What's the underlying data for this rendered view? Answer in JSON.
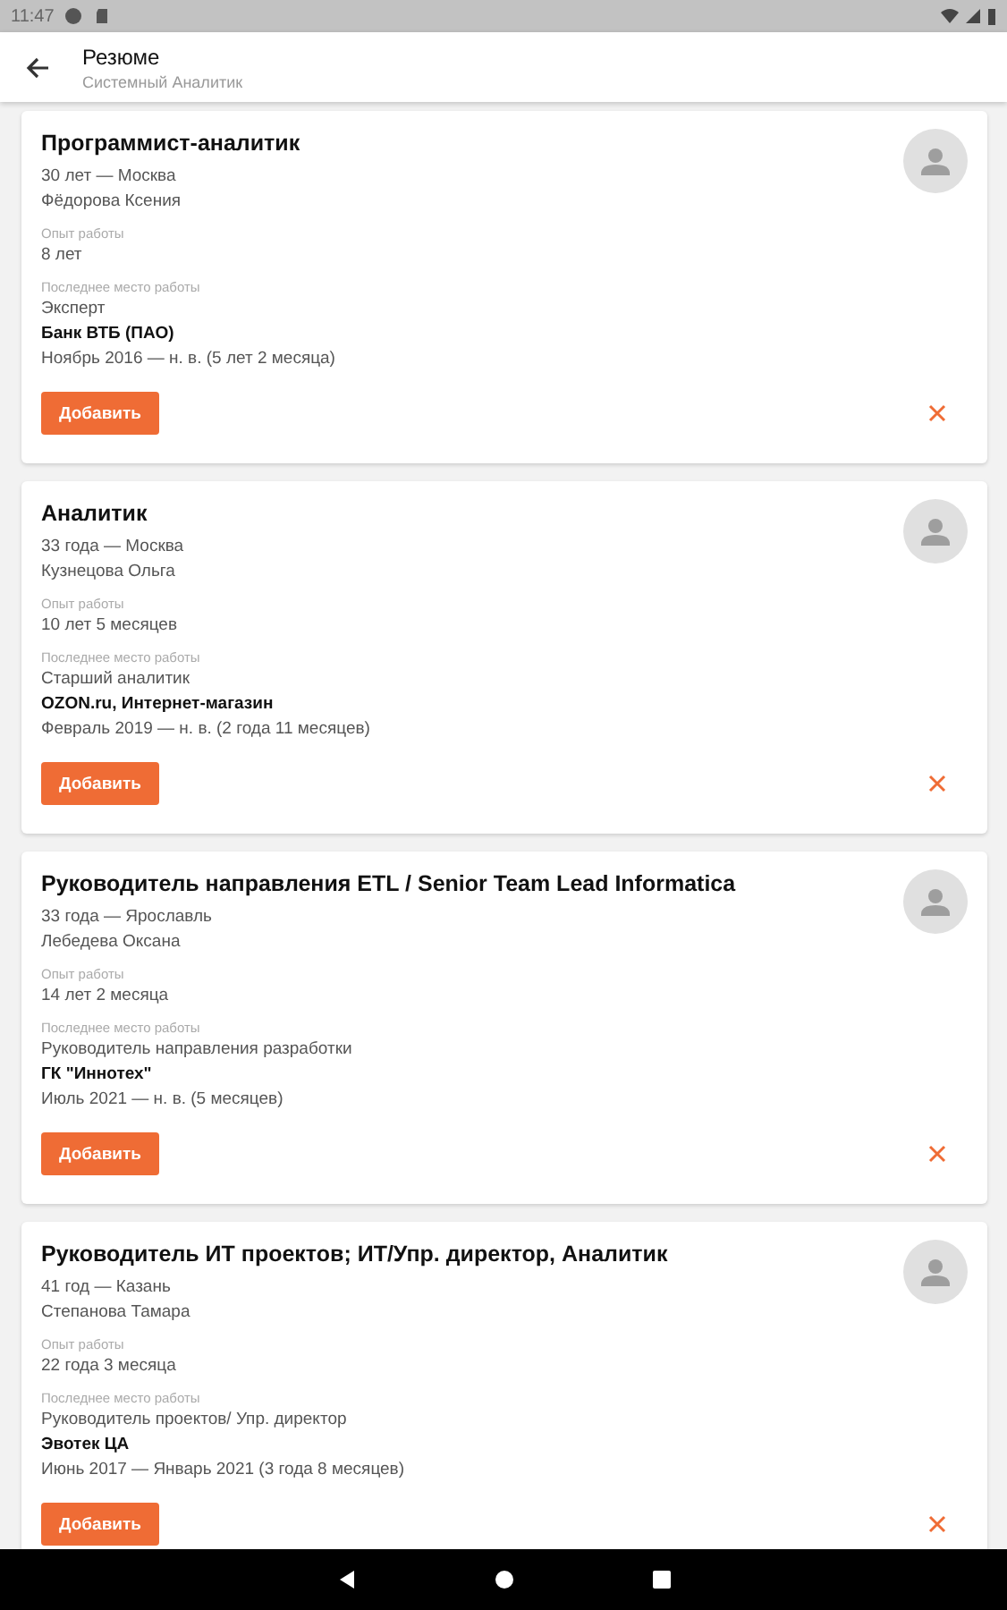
{
  "status_bar": {
    "time": "11:47"
  },
  "app_bar": {
    "title": "Резюме",
    "subtitle": "Системный Аналитик"
  },
  "resumes": [
    {
      "title": "Программист-аналитик",
      "age_city": "30 лет — Москва",
      "name": "Фёдорова Ксения",
      "experience_label": "Опыт работы",
      "experience": "8 лет",
      "last_job_label": "Последнее место работы",
      "position": "Эксперт",
      "company": "Банк ВТБ (ПАО)",
      "period": "Ноябрь 2016 — н. в. (5 лет  2 месяца)",
      "add_button": "Добавить"
    },
    {
      "title": "Аналитик",
      "age_city": "33 года — Москва",
      "name": "Кузнецова Ольга",
      "experience_label": "Опыт работы",
      "experience": "10 лет 5 месяцев",
      "last_job_label": "Последнее место работы",
      "position": "Старший аналитик",
      "company": "OZON.ru, Интернет-магазин",
      "period": "Февраль 2019 — н. в. (2 года  11 месяцев)",
      "add_button": "Добавить"
    },
    {
      "title": "Руководитель направления ETL / Senior Team Lead Informatica",
      "age_city": "33 года — Ярославль",
      "name": "Лебедева Оксана",
      "experience_label": "Опыт работы",
      "experience": "14 лет 2 месяца",
      "last_job_label": "Последнее место работы",
      "position": "Руководитель направления разработки",
      "company": "ГК \"Иннотех\"",
      "period": "Июль 2021 — н. в. (5 месяцев)",
      "add_button": "Добавить"
    },
    {
      "title": "Руководитель ИТ проектов; ИТ/Упр. директор,  Аналитик",
      "age_city": "41 год — Казань",
      "name": "Степанова Тамара",
      "experience_label": "Опыт работы",
      "experience": "22 года 3 месяца",
      "last_job_label": "Последнее место работы",
      "position": "Руководитель проектов/ Упр. директор",
      "company": "Эвотек ЦА",
      "period": "Июнь 2017 — Январь 2021 (3 года  8 месяцев)",
      "add_button": "Добавить"
    }
  ]
}
